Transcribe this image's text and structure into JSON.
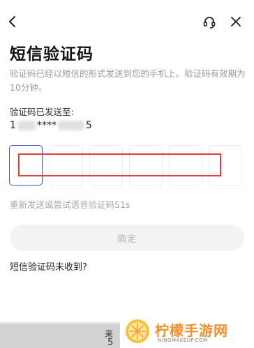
{
  "header": {
    "back_icon": "chevron-left-icon",
    "support_icon": "headset-icon",
    "close_icon": "close-icon"
  },
  "page": {
    "title": "短信验证码",
    "description": "验证码已经以短信的形式发送到您的手机上。验证码有效期为10分钟。",
    "sent_label": "验证码已发送至:",
    "phone_prefix": "1",
    "phone_masked": "****",
    "phone_suffix": "5"
  },
  "code_input": {
    "box_count": 6,
    "active_index": 0,
    "accent": "#3f57c7",
    "highlight_color": "#ea3b3b"
  },
  "resend_text": "重新发送或尝试语音验证码51s",
  "confirm_button": "确定",
  "not_received_link": "短信验证码未收到?",
  "keyboard": {
    "char1": "来",
    "char2": "5"
  },
  "watermark": {
    "name": "柠檬手游网",
    "url": "NINGMAKEUP.COM"
  }
}
